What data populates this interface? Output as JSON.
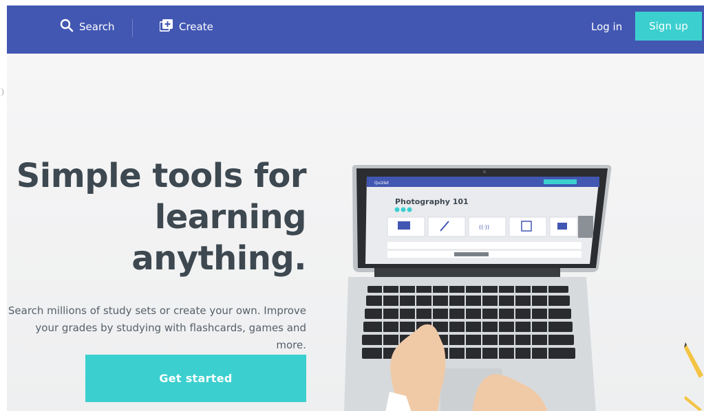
{
  "nav": {
    "search_label": "Search",
    "create_label": "Create",
    "login_label": "Log in",
    "signup_label": "Sign up",
    "search_icon": "search-icon",
    "create_icon": "add-set-icon"
  },
  "hero": {
    "title_line1": "Simple tools for",
    "title_line2": "learning",
    "title_line3": "anything.",
    "subtitle_line1": "Search millions of study sets or create your own. Improve",
    "subtitle_line2": "your grades by studying with flashcards, games and more.",
    "cta_label": "Get started"
  },
  "laptop_screen": {
    "brand": "Quizlet",
    "set_title": "Photography 101"
  },
  "colors": {
    "nav_bg": "#4257b2",
    "accent": "#3ccfcf",
    "title_text": "#3d4850",
    "body_text": "#56606a"
  }
}
